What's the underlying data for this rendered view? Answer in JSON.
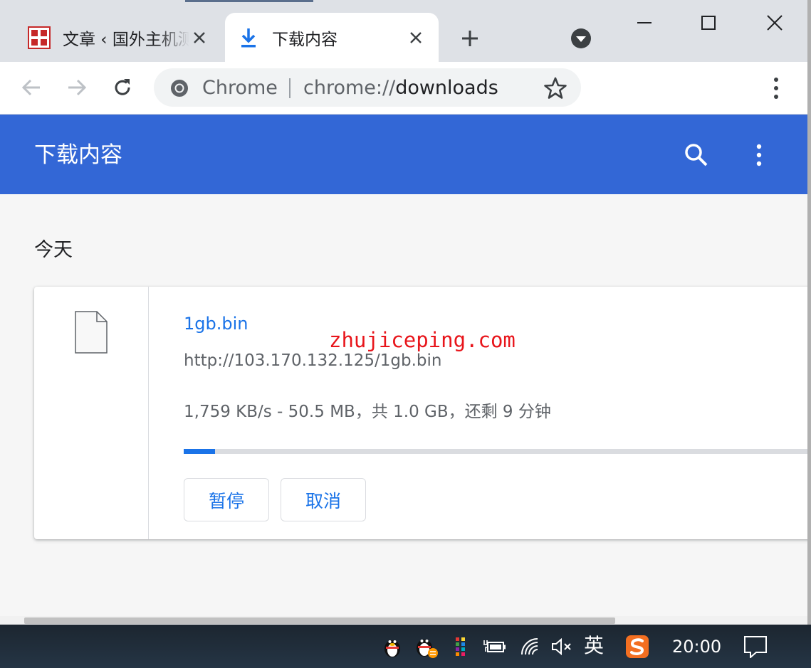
{
  "tabs": [
    {
      "title": "文章 ‹ 国外主机测评 — WordPress",
      "active": false,
      "icon": "site-favicon"
    },
    {
      "title": "下载内容",
      "active": true,
      "icon": "download-icon"
    }
  ],
  "omnibox": {
    "chip": "Chrome",
    "url_scheme": "chrome://",
    "url_host": "downloads"
  },
  "header": {
    "title": "下载内容"
  },
  "section": {
    "date_label": "今天"
  },
  "download": {
    "file_name": "1gb.bin",
    "url": "http://103.170.132.125/1gb.bin",
    "status": "1,759 KB/s - 50.5 MB，共 1.0 GB，还剩 9 分钟",
    "progress_fraction": 0.0493,
    "pause_label": "暂停",
    "cancel_label": "取消"
  },
  "watermark": "zhujiceping.com",
  "taskbar": {
    "ime": "英",
    "clock": "20:00"
  },
  "colors": {
    "accent": "#3367d6",
    "link": "#1a73e8",
    "watermark": "#e8151b"
  }
}
